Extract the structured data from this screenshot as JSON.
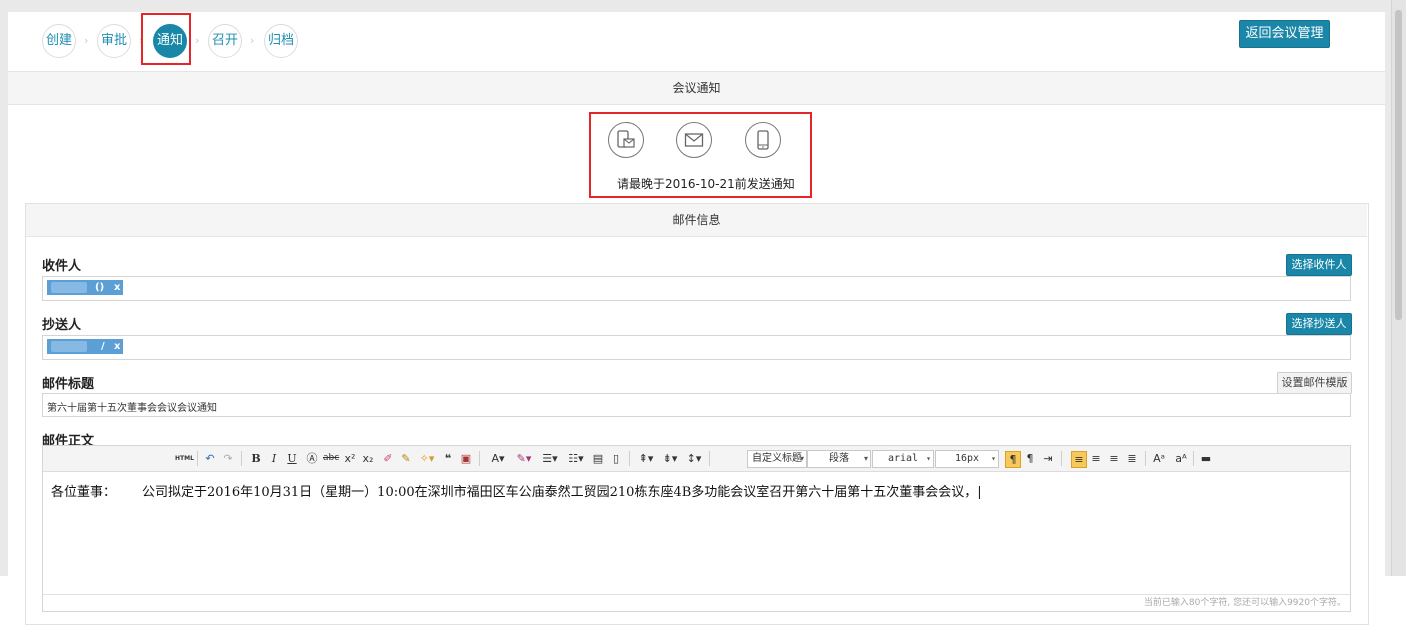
{
  "steps": [
    "创建",
    "审批",
    "通知",
    "召开",
    "归档"
  ],
  "active_step": "通知",
  "back_button": "返回会议管理",
  "meeting_notice": {
    "title": "会议通知",
    "icons": [
      "sms-mail-icon",
      "email-icon",
      "phone-icon"
    ],
    "hint": "请最晚于2016-10-21前发送通知"
  },
  "mail": {
    "title": "邮件信息",
    "recipient": {
      "label": "收件人",
      "button": "选择收件人",
      "tag_suffix": "()",
      "tag_remove": "x"
    },
    "cc": {
      "label": "抄送人",
      "button": "选择抄送人",
      "tag_suffix": "/",
      "tag_remove": "x"
    },
    "subject": {
      "label": "邮件标题",
      "button": "设置邮件模版",
      "value": "第六十届第十五次董事会会议会议通知"
    },
    "body": {
      "label": "邮件正文",
      "greeting": "各位董事：",
      "content": "公司拟定于2016年10月31日（星期一）10:00在深圳市福田区车公庙泰然工贸园210栋东座4B多功能会议室召开第六十届第十五次董事会会议，|",
      "status": "当前已输入80个字符, 您还可以输入9920个字符。"
    }
  },
  "toolbar": {
    "html": "HTML",
    "bold": "B",
    "italic": "I",
    "underline": "U",
    "font_color": "A",
    "custom_title": "自定义标题",
    "paragraph": "段落",
    "font": "arial",
    "size": "16px"
  },
  "colors": {
    "accent": "#1887a8",
    "highlight": "#e3262c"
  }
}
